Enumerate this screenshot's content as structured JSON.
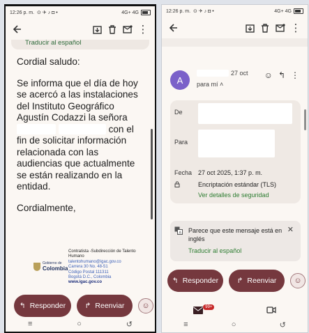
{
  "left": {
    "status": {
      "time": "12:26 p. m.",
      "signal": "4G+ 4G"
    },
    "translate_link": "Traducir al español",
    "greeting": "Cordial saludo:",
    "para1_a": "Se informa que el día de hoy se acercó a las instalaciones del Instituto Geográfico Agustín Codazzi la señora",
    "para1_b": "con el fin de solicitar información relacionada con las audiencias que actualmente se están realizando en la entidad.",
    "closing": "Cordialmente,",
    "signature": {
      "logo_top": "Gobierno de",
      "logo_main": "Colombia",
      "role": "Contratista -Subdirección de Talento Humano",
      "email": "talentohumano@igac.gov.co",
      "address": "Carrera 30 No. 48-51",
      "postal": "Código Postal 111311",
      "city": "Bogotá D.C., Colombia",
      "website": "www.igac.gov.co"
    },
    "reply_label": "Responder",
    "forward_label": "Reenviar"
  },
  "right": {
    "status": {
      "time": "12:26 p. m.",
      "signal": "4G+ 4G"
    },
    "avatar_letter": "A",
    "date_short": "27 oct",
    "to_me": "para mí",
    "labels": {
      "from": "De",
      "to": "Para",
      "date": "Fecha"
    },
    "date_full": "27 oct 2025, 1:37 p. m.",
    "encryption": "Encriptación estándar (TLS)",
    "security_link": "Ver detalles de seguridad",
    "notice_text": "Parece que este mensaje está en inglés",
    "notice_link": "Traducir al español",
    "reply_label": "Responder",
    "forward_label": "Reenviar",
    "mail_badge": "99+"
  },
  "colors": {
    "accent": "#75383e",
    "link_green": "#2e7d32",
    "avatar": "#7b61c9"
  }
}
